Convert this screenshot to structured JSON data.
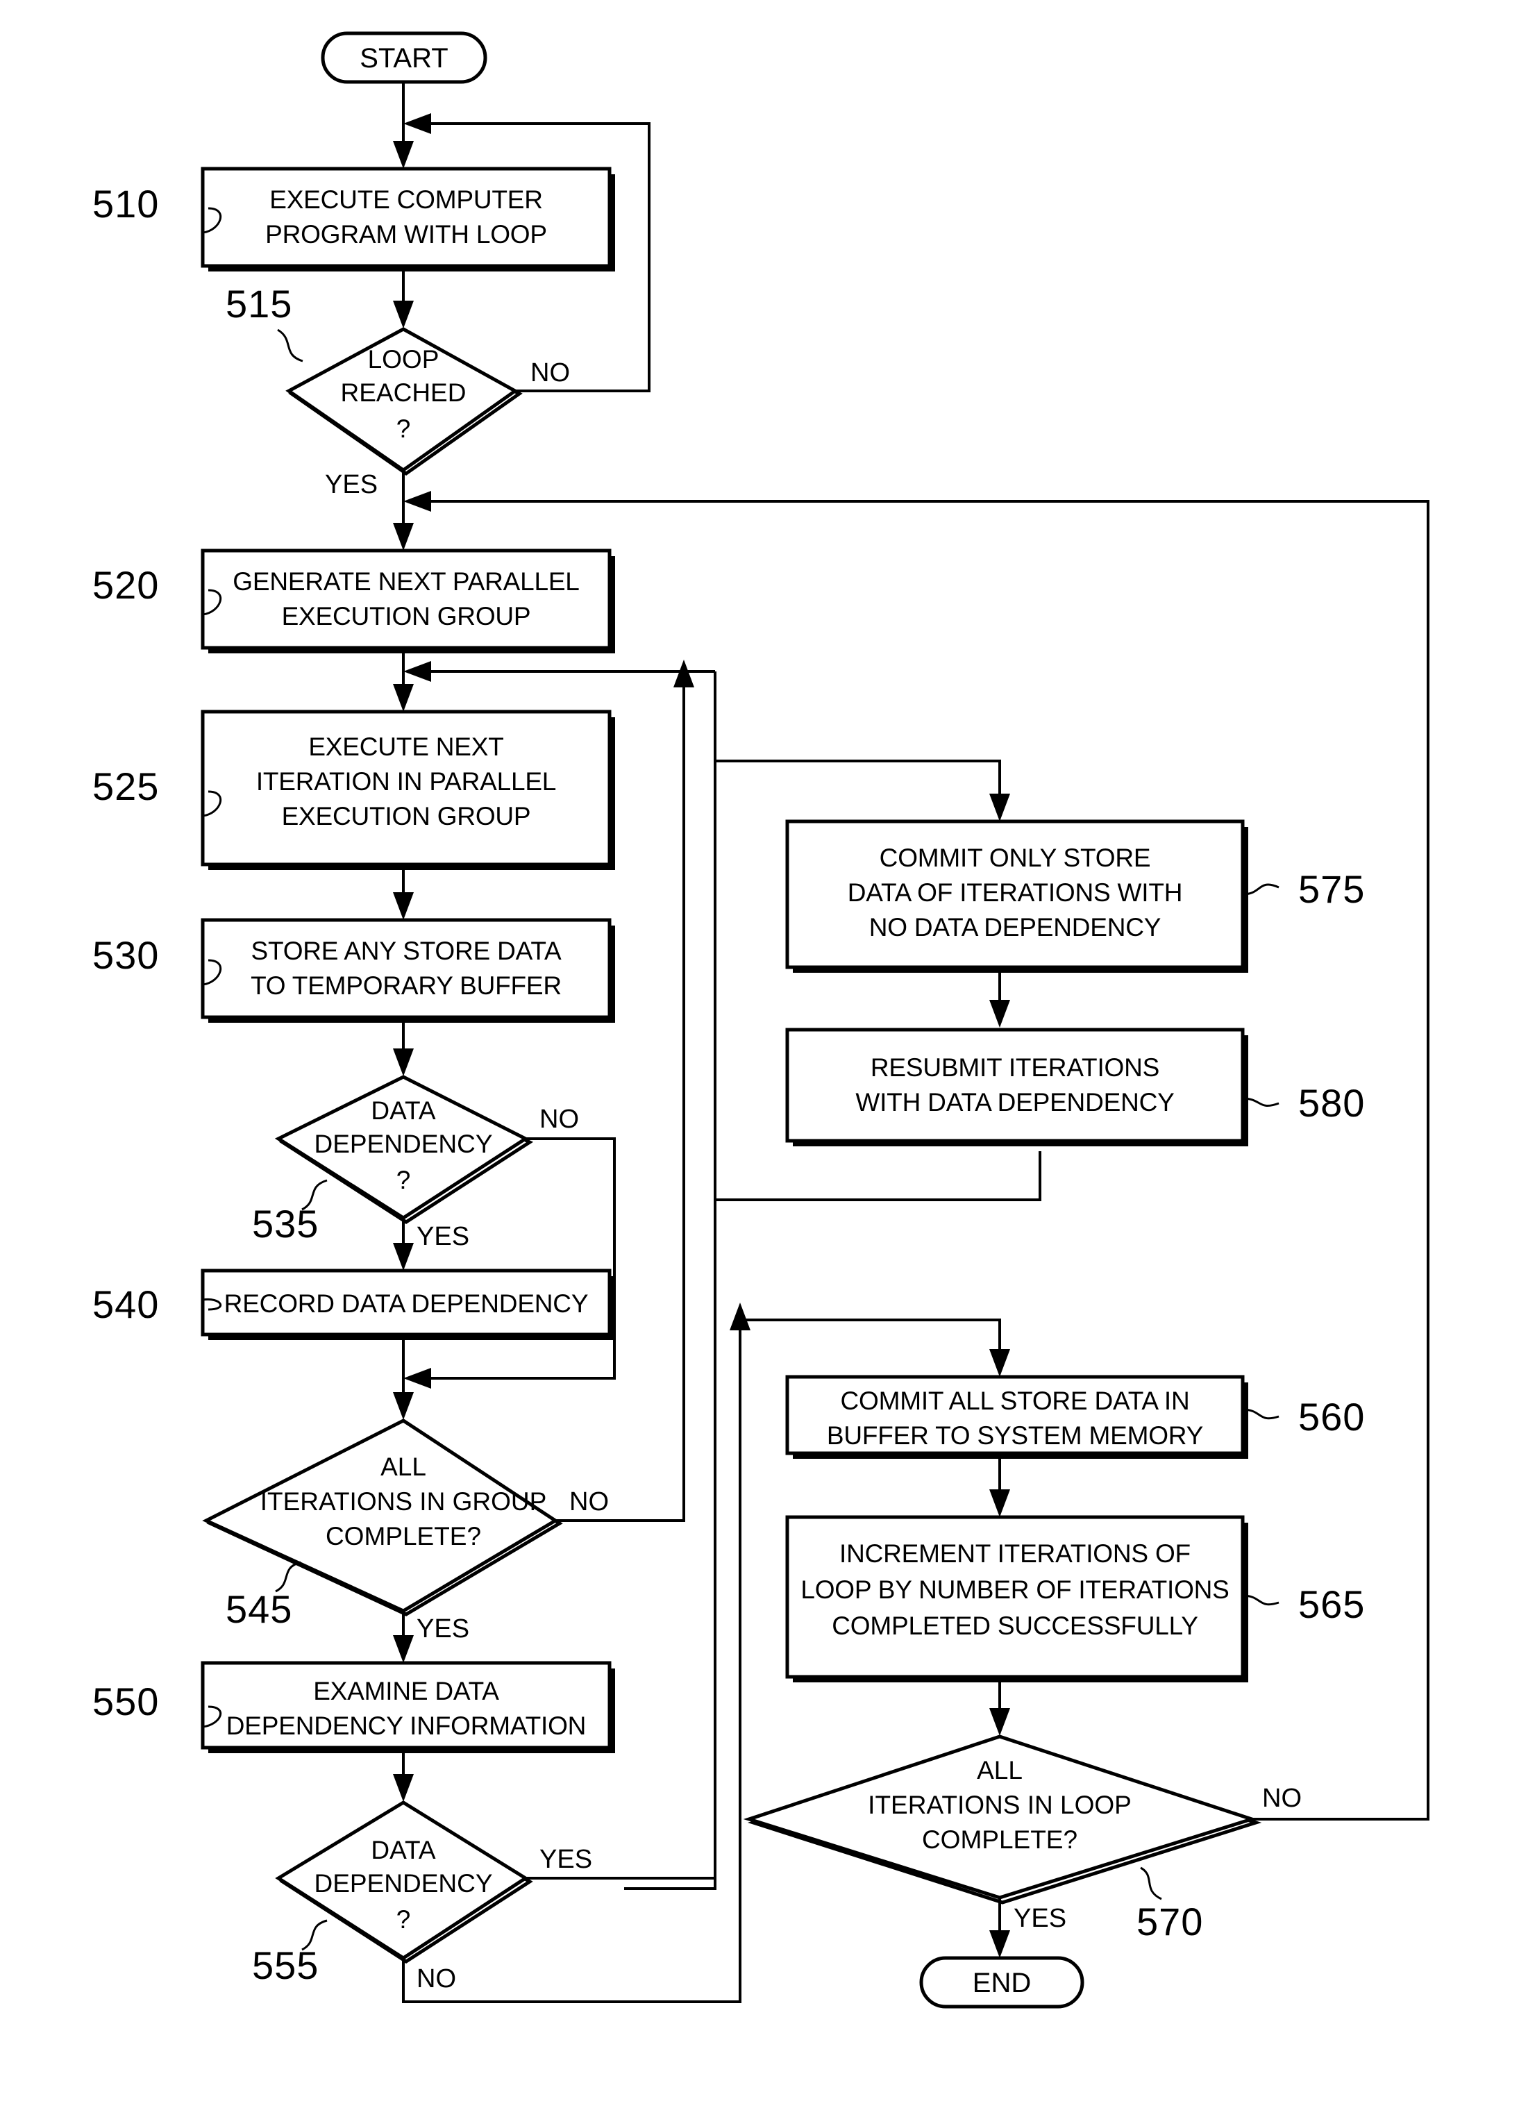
{
  "figure": {
    "type": "flowchart",
    "title": "",
    "nodes": [
      {
        "id": "start",
        "ref": "",
        "shape": "terminator",
        "lines": [
          "START"
        ]
      },
      {
        "id": "n510",
        "ref": "510",
        "shape": "process",
        "lines": [
          "EXECUTE COMPUTER",
          "PROGRAM WITH LOOP"
        ]
      },
      {
        "id": "n515",
        "ref": "515",
        "shape": "decision",
        "lines": [
          "LOOP",
          "REACHED",
          "?"
        ]
      },
      {
        "id": "n520",
        "ref": "520",
        "shape": "process",
        "lines": [
          "GENERATE NEXT PARALLEL",
          "EXECUTION GROUP"
        ]
      },
      {
        "id": "n525",
        "ref": "525",
        "shape": "process",
        "lines": [
          "EXECUTE NEXT",
          "ITERATION IN PARALLEL",
          "EXECUTION GROUP"
        ]
      },
      {
        "id": "n530",
        "ref": "530",
        "shape": "process",
        "lines": [
          "STORE ANY STORE DATA",
          "TO TEMPORARY BUFFER"
        ]
      },
      {
        "id": "n535",
        "ref": "535",
        "shape": "decision",
        "lines": [
          "DATA",
          "DEPENDENCY",
          "?"
        ]
      },
      {
        "id": "n540",
        "ref": "540",
        "shape": "process",
        "lines": [
          "RECORD DATA DEPENDENCY"
        ]
      },
      {
        "id": "n545",
        "ref": "545",
        "shape": "decision",
        "lines": [
          "ALL",
          "ITERATIONS IN GROUP",
          "COMPLETE?"
        ]
      },
      {
        "id": "n550",
        "ref": "550",
        "shape": "process",
        "lines": [
          "EXAMINE DATA",
          "DEPENDENCY INFORMATION"
        ]
      },
      {
        "id": "n555",
        "ref": "555",
        "shape": "decision",
        "lines": [
          "DATA",
          "DEPENDENCY",
          "?"
        ]
      },
      {
        "id": "n575",
        "ref": "575",
        "shape": "process",
        "lines": [
          "COMMIT ONLY STORE",
          "DATA OF ITERATIONS WITH",
          "NO DATA DEPENDENCY"
        ]
      },
      {
        "id": "n580",
        "ref": "580",
        "shape": "process",
        "lines": [
          "RESUBMIT ITERATIONS",
          "WITH DATA DEPENDENCY"
        ]
      },
      {
        "id": "n560",
        "ref": "560",
        "shape": "process",
        "lines": [
          "COMMIT ALL STORE DATA IN",
          "BUFFER TO SYSTEM MEMORY"
        ]
      },
      {
        "id": "n565",
        "ref": "565",
        "shape": "process",
        "lines": [
          "INCREMENT ITERATIONS OF",
          "LOOP BY NUMBER OF ITERATIONS",
          "COMPLETED SUCCESSFULLY"
        ]
      },
      {
        "id": "n570",
        "ref": "570",
        "shape": "decision",
        "lines": [
          "ALL",
          "ITERATIONS IN LOOP",
          "COMPLETE?"
        ]
      },
      {
        "id": "end",
        "ref": "",
        "shape": "terminator",
        "lines": [
          "END"
        ]
      }
    ],
    "branch_labels": {
      "b515_no": "NO",
      "b515_yes": "YES",
      "b535_no": "NO",
      "b535_yes": "YES",
      "b545_no": "NO",
      "b545_yes": "YES",
      "b555_yes": "YES",
      "b555_no": "NO",
      "b570_no": "NO",
      "b570_yes": "YES"
    },
    "ref_numbers": {
      "r510": "510",
      "r515": "515",
      "r520": "520",
      "r525": "525",
      "r530": "530",
      "r535": "535",
      "r540": "540",
      "r545": "545",
      "r550": "550",
      "r555": "555",
      "r560": "560",
      "r565": "565",
      "r570": "570",
      "r575": "575",
      "r580": "580"
    },
    "node_text": {
      "start": "START",
      "end": "END",
      "n510_l1": "EXECUTE COMPUTER",
      "n510_l2": "PROGRAM WITH LOOP",
      "n515_l1": "LOOP",
      "n515_l2": "REACHED",
      "n515_l3": "?",
      "n520_l1": "GENERATE NEXT PARALLEL",
      "n520_l2": "EXECUTION GROUP",
      "n525_l1": "EXECUTE NEXT",
      "n525_l2": "ITERATION IN PARALLEL",
      "n525_l3": "EXECUTION GROUP",
      "n530_l1": "STORE ANY STORE DATA",
      "n530_l2": "TO TEMPORARY BUFFER",
      "n535_l1": "DATA",
      "n535_l2": "DEPENDENCY",
      "n535_l3": "?",
      "n540_l1": "RECORD DATA DEPENDENCY",
      "n545_l1": "ALL",
      "n545_l2": "ITERATIONS IN GROUP",
      "n545_l3": "COMPLETE?",
      "n550_l1": "EXAMINE DATA",
      "n550_l2": "DEPENDENCY INFORMATION",
      "n555_l1": "DATA",
      "n555_l2": "DEPENDENCY",
      "n555_l3": "?",
      "n575_l1": "COMMIT ONLY STORE",
      "n575_l2": "DATA OF ITERATIONS WITH",
      "n575_l3": "NO DATA DEPENDENCY",
      "n580_l1": "RESUBMIT ITERATIONS",
      "n580_l2": "WITH DATA DEPENDENCY",
      "n560_l1": "COMMIT ALL STORE DATA IN",
      "n560_l2": "BUFFER TO SYSTEM MEMORY",
      "n565_l1": "INCREMENT ITERATIONS OF",
      "n565_l2": "LOOP BY NUMBER OF ITERATIONS",
      "n565_l3": "COMPLETED SUCCESSFULLY",
      "n570_l1": "ALL",
      "n570_l2": "ITERATIONS IN LOOP",
      "n570_l3": "COMPLETE?"
    },
    "colors": {
      "stroke": "#000000",
      "fill": "#ffffff",
      "background": "#ffffff"
    }
  }
}
